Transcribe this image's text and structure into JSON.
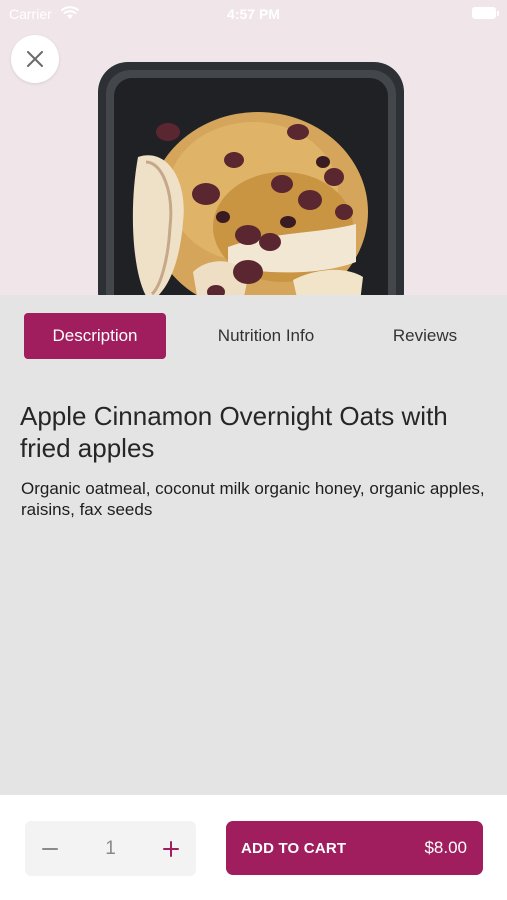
{
  "status_bar": {
    "carrier": "Carrier",
    "time": "4:57 PM"
  },
  "product": {
    "title": "Apple Cinnamon Overnight Oats with fried apples",
    "description": "Organic oatmeal, coconut milk organic honey, organic apples, raisins, fax seeds"
  },
  "tabs": [
    {
      "label": "Description",
      "active": true
    },
    {
      "label": "Nutrition Info",
      "active": false
    },
    {
      "label": "Reviews",
      "active": false
    }
  ],
  "cart": {
    "quantity": "1",
    "add_label": "ADD TO CART",
    "price": "$8.00"
  },
  "colors": {
    "accent": "#a01d5e",
    "hero_bg": "#f0e6ea",
    "page_bg": "#e4e4e4"
  },
  "icons": [
    "close-icon",
    "minus-icon",
    "plus-icon",
    "wifi-icon",
    "battery-icon"
  ]
}
